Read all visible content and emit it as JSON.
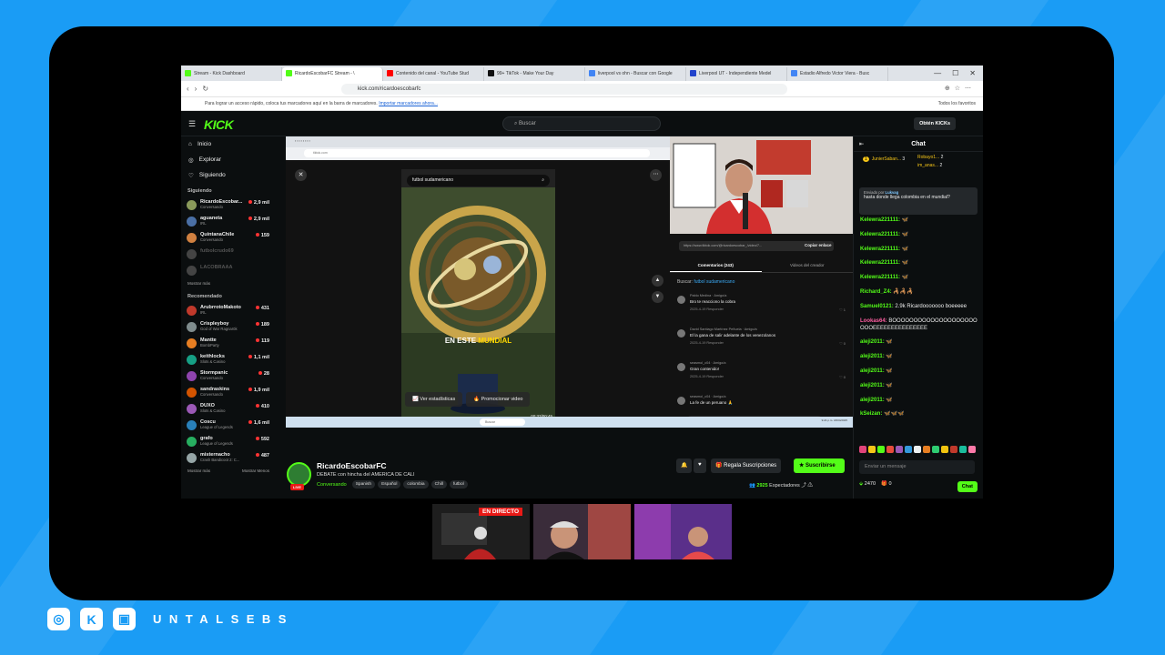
{
  "browser": {
    "tabs": [
      {
        "label": "Stream - Kick Dashboard",
        "color": "#53fc18"
      },
      {
        "label": "RicardoEscobarFC Stream - \\",
        "color": "#53fc18"
      },
      {
        "label": "Contenido del canal - YouTube Stud",
        "color": "#ff0000"
      },
      {
        "label": "99+ TikTok - Make Your Day",
        "color": "#111111"
      },
      {
        "label": "liverpool vs ohn - Buscar con Google",
        "color": "#4285f4"
      },
      {
        "label": "Liverpool UT - Independiente Medel",
        "color": "#2244cc"
      },
      {
        "label": "Estadio Alfredo Victor Viera - Busc",
        "color": "#4285f4"
      }
    ],
    "url": "kick.com/ricardoescobarfc",
    "bookmarks_text": "Para lograr un acceso rápido, coloca tus marcadores aquí en la barra de marcadores.",
    "bookmarks_link": "Importar marcadores ahora...",
    "favorites": "Todos los favoritos"
  },
  "kick": {
    "logo": "KICK",
    "search_placeholder": "Buscar",
    "get_kicks": "Obtén KICKs"
  },
  "sidebar": {
    "nav": [
      {
        "label": "Inicio",
        "icon": "home-icon",
        "glyph": "⌂"
      },
      {
        "label": "Explorar",
        "icon": "compass-icon",
        "glyph": "◎"
      },
      {
        "label": "Siguiendo",
        "icon": "heart-icon",
        "glyph": "♡"
      }
    ],
    "following_title": "Siguiendo",
    "following": [
      {
        "name": "RicardoEscobar...",
        "cat": "Conversando",
        "viewers": "2,9 mil",
        "color": "#8a9a5b",
        "off": false
      },
      {
        "name": "aguaneta",
        "cat": "IRL",
        "viewers": "2,9 mil",
        "color": "#4a6fa5",
        "off": false
      },
      {
        "name": "QuintanaChile",
        "cat": "Conversando",
        "viewers": "159",
        "color": "#d08040",
        "off": false
      },
      {
        "name": "futbolcrudo69",
        "cat": "",
        "viewers": "",
        "color": "#444444",
        "off": true
      },
      {
        "name": "LACOBRAAA",
        "cat": "",
        "viewers": "",
        "color": "#444444",
        "off": true
      }
    ],
    "show_more": "Mostrar más",
    "recommended_title": "Recomendado",
    "recommended": [
      {
        "name": "ArubrrotoMakoto",
        "cat": "IRL",
        "viewers": "431",
        "color": "#c0392b"
      },
      {
        "name": "Crispleyboy",
        "cat": "God of War Ragnarök",
        "viewers": "189",
        "color": "#7f8c8d"
      },
      {
        "name": "Mantte",
        "cat": "BombParty",
        "viewers": "119",
        "color": "#e67e22"
      },
      {
        "name": "keithlocks",
        "cat": "Slots & Casino",
        "viewers": "1,1 mil",
        "color": "#16a085"
      },
      {
        "name": "Stormpanic",
        "cat": "Conversando",
        "viewers": "28",
        "color": "#8e44ad"
      },
      {
        "name": "sandraskins",
        "cat": "Conversando",
        "viewers": "1,9 mil",
        "color": "#d35400"
      },
      {
        "name": "DUXO",
        "cat": "Slots & Casino",
        "viewers": "410",
        "color": "#9b59b6"
      },
      {
        "name": "Coscu",
        "cat": "League of Legends",
        "viewers": "1,6 mil",
        "color": "#2980b9"
      },
      {
        "name": "grafo",
        "cat": "League of Legends",
        "viewers": "592",
        "color": "#27ae60"
      },
      {
        "name": "misternacho",
        "cat": "Crash Bandicoot 2: C...",
        "viewers": "487",
        "color": "#95a5a6"
      }
    ],
    "show_more2": "Mostrar más",
    "show_less": "Mostrar Menos"
  },
  "inner": {
    "tiktok_search": "futbol sudamericano",
    "mundial_white": "EN ESTE",
    "mundial_yellow": "MUNDIAL",
    "btn_stats": "Ver estadísticas",
    "btn_promote": "Promocionar video",
    "video_progress": 0.7,
    "time": "00:37/00:45",
    "link": "https://www.tiktok.com/@ricardoescobar_/video/7...",
    "copy_link": "Copiar enlace",
    "tab_comments": "Comentarios (243)",
    "tab_creator": "Videos del creador",
    "search_label": "Buscar:",
    "search_term": "futbol sudamericano",
    "comments": [
      {
        "user": "Pablo Medina · Amigo/a",
        "text": "Bro te reacciono la cobra",
        "date": "2025-4-19",
        "reply": "Responder",
        "likes": "1"
      },
      {
        "user": "David Santiago Martínez Peñuela · Amigo/a",
        "text": "El la gana de salir adelante de los venezolanos",
        "date": "2025-4-19",
        "reply": "Responder",
        "likes": "0"
      },
      {
        "user": "seasmol_c04 · Amigo/a",
        "text": "Gran contenido!",
        "date": "2025-4-19",
        "reply": "Responder",
        "likes": "0"
      },
      {
        "user": "seasmol_c04 · Amigo/a",
        "text": "La fe de un peruano 🙏",
        "date": "",
        "reply": "",
        "likes": ""
      }
    ],
    "comment_placeholder": "Añadir comentario...",
    "taskbar_search": "Buscar",
    "taskbar_time": "9:24 p.m. 18/04/2025"
  },
  "stream": {
    "name": "RicardoEscobarFC",
    "title": "DEBATE con hincha del AMERICA DE CALI",
    "category": "Conversando",
    "tags": [
      "Spanish",
      "Español",
      "colombia",
      "Chill",
      "futbol"
    ],
    "live_badge": "LIVE",
    "gift_subs": "Regala Suscripciones",
    "subscribe": "Suscribirse",
    "viewers": "2925",
    "viewers_label": "Espectadores"
  },
  "chat": {
    "title": "Chat",
    "leaderboard": [
      {
        "rank": "1",
        "name": "JunierSaban...",
        "count": "3"
      },
      {
        "rank": "",
        "name": "Robayo1...",
        "count": "2"
      },
      {
        "rank": "",
        "name": "im_anas...",
        "count": "2"
      }
    ],
    "pinned_by_label": "Enviado por",
    "pinned_by": "Lukvag",
    "pinned_text": "hasta donde llega colombia en el mundial?",
    "messages": [
      {
        "user": "Kelewra221111:",
        "text": "",
        "color": "#53fc18",
        "emote": "🦋"
      },
      {
        "user": "Kelewra221111:",
        "text": "",
        "color": "#53fc18",
        "emote": "🦋"
      },
      {
        "user": "Kelewra221111:",
        "text": "",
        "color": "#53fc18",
        "emote": "🦋"
      },
      {
        "user": "Kelewra221111:",
        "text": "",
        "color": "#53fc18",
        "emote": "🦋"
      },
      {
        "user": "Kelewra221111:",
        "text": "",
        "color": "#53fc18",
        "emote": "🦋"
      },
      {
        "user": "Richard_Z4:",
        "text": "",
        "color": "#53fc18",
        "emote": "🦂🦂🦂"
      },
      {
        "user": "Samuel0121:",
        "text": "2.9k Ricardooooooo boeeeee",
        "color": "#53fc18",
        "emote": ""
      },
      {
        "user": "Lookas64:",
        "text": "BOOOOOOOOOOOOOOOOOOOOOOOEEEEEEEEEEEEEEE",
        "color": "#ff5fa2",
        "emote": ""
      },
      {
        "user": "aleji2011:",
        "text": "",
        "color": "#53fc18",
        "emote": "🦋"
      },
      {
        "user": "aleji2011:",
        "text": "",
        "color": "#53fc18",
        "emote": "🦋"
      },
      {
        "user": "aleji2011:",
        "text": "",
        "color": "#53fc18",
        "emote": "🦋"
      },
      {
        "user": "aleji2011:",
        "text": "",
        "color": "#53fc18",
        "emote": "🦋"
      },
      {
        "user": "aleji2011:",
        "text": "",
        "color": "#53fc18",
        "emote": "🦋"
      },
      {
        "user": "kSeizan:",
        "text": "",
        "color": "#53fc18",
        "emote": "🦋🦋🦋"
      }
    ],
    "input_placeholder": "Enviar un mensaje",
    "points": "2470",
    "gifts": "0",
    "send": "Chat"
  },
  "overlay": {
    "en_directo": "EN DIRECTO",
    "brand": "UNTALSEBS"
  }
}
